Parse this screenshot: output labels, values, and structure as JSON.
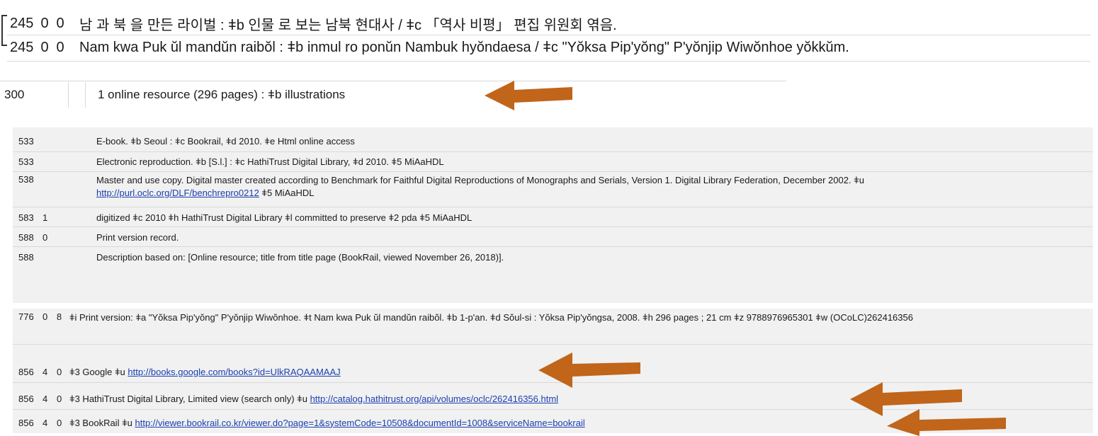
{
  "top_fields": [
    {
      "tag": "245",
      "ind1": "0",
      "ind2": "0",
      "text": "남 과 북 을 만든 라이벌 : ǂb 인물 로 보는 남북 현대사 / ǂc 「역사 비평」 편집 위원회 엮음."
    },
    {
      "tag": "245",
      "ind1": "0",
      "ind2": "0",
      "text": "Nam kwa Puk ŭl mandŭn raibŏl : ǂb inmul ro ponŭn Nambuk hyŏndaesa / ǂc \"Yŏksa Pip'yŏng\" P'yŏnjip Wiwŏnhoe yŏkkŭm."
    },
    {
      "tag": "300",
      "ind1": "",
      "ind2": "",
      "text": "1 online resource (296 pages) : ǂb illustrations"
    }
  ],
  "notes": [
    {
      "tag": "533",
      "ind1": "",
      "ind2": "",
      "text": "E-book. ǂb Seoul : ǂc Bookrail, ǂd 2010. ǂe Html online access"
    },
    {
      "tag": "533",
      "ind1": "",
      "ind2": "",
      "text": "Electronic reproduction. ǂb [S.l.] : ǂc HathiTrust Digital Library, ǂd 2010. ǂ5 MiAaHDL"
    },
    {
      "tag": "538",
      "ind1": "",
      "ind2": "",
      "text": "Master and use copy. Digital master created according to Benchmark for Faithful Digital Reproductions of Monographs and Serials, Version 1. Digital Library Federation, December 2002. ǂu ",
      "link": "http://purl.oclc.org/DLF/benchrepro0212",
      "after": " ǂ5 MiAaHDL"
    },
    {
      "tag": "583",
      "ind1": "1",
      "ind2": "",
      "text": "digitized ǂc 2010 ǂh HathiTrust Digital Library ǂl committed to preserve ǂ2 pda ǂ5 MiAaHDL"
    },
    {
      "tag": "588",
      "ind1": "0",
      "ind2": "",
      "text": "Print version record."
    },
    {
      "tag": "588",
      "ind1": "",
      "ind2": "",
      "text": "Description based on: [Online resource; title from title page (BookRail, viewed November 26, 2018)]."
    }
  ],
  "links": [
    {
      "tag": "776",
      "ind1": "0",
      "ind2": "8",
      "text": "ǂi Print version: ǂa \"Yŏksa Pip'yŏng\" P'yŏnjip Wiwŏnhoe. ǂt Nam kwa Puk ŭl mandŭn raibŏl. ǂb 1-p'an. ǂd Sŏul-si : Yŏksa Pip'yŏngsa, 2008. ǂh 296 pages ; 21 cm ǂz 9788976965301 ǂw (OCoLC)262416356"
    },
    {
      "tag": "856",
      "ind1": "4",
      "ind2": "0",
      "text": "ǂ3 Google ǂu ",
      "link": "http://books.google.com/books?id=UlkRAQAAMAAJ"
    },
    {
      "tag": "856",
      "ind1": "4",
      "ind2": "0",
      "text": "ǂ3 HathiTrust Digital Library, Limited view (search only) ǂu ",
      "link": "http://catalog.hathitrust.org/api/volumes/oclc/262416356.html"
    },
    {
      "tag": "856",
      "ind1": "4",
      "ind2": "0",
      "text": "ǂ3 BookRail ǂu ",
      "link": "http://viewer.bookrail.co.kr/viewer.do?page=1&systemCode=10508&documentId=1008&serviceName=bookrail"
    }
  ],
  "colors": {
    "arrow": "#c0651a",
    "link": "#1a3fb0"
  },
  "icons": [
    "arrow-300",
    "arrow-856-google",
    "arrow-856-hathitrust",
    "arrow-856-bookrail"
  ]
}
